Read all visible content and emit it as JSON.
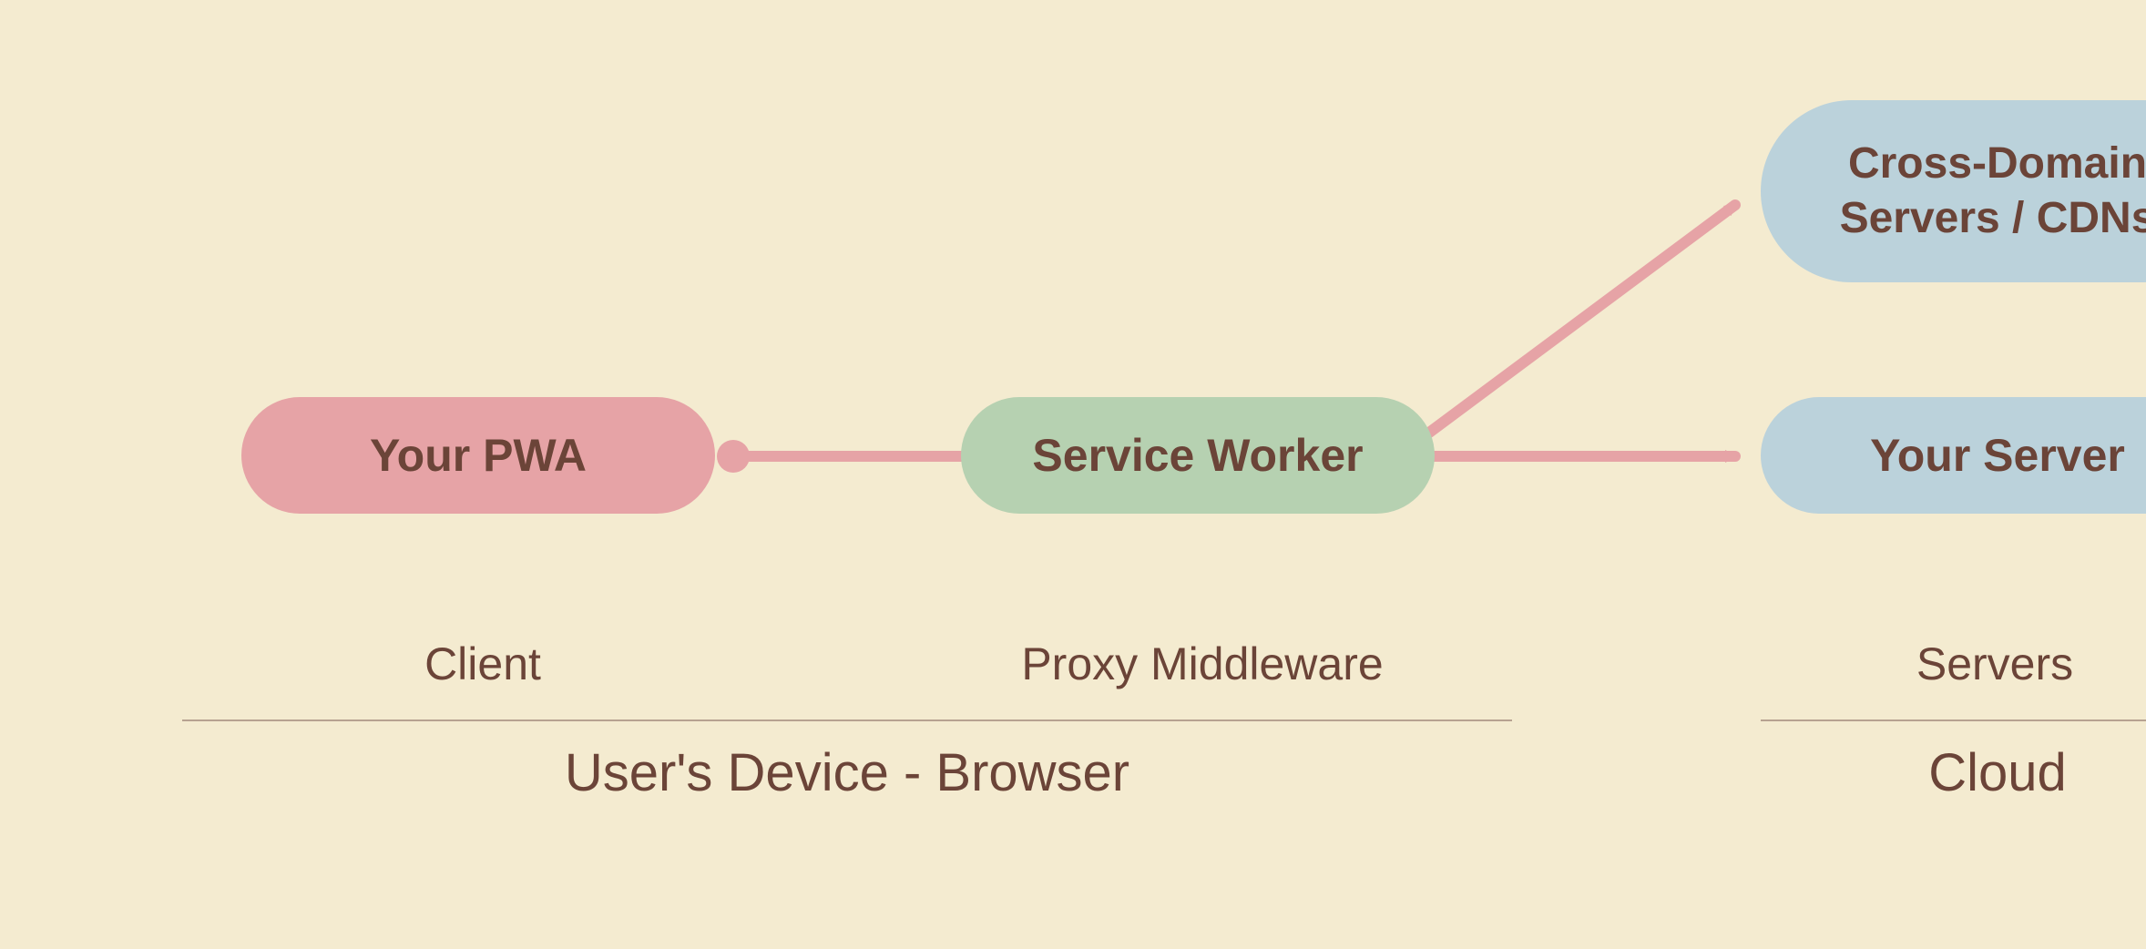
{
  "nodes": {
    "pwa": {
      "label": "Your PWA"
    },
    "service_worker": {
      "label": "Service Worker"
    },
    "cross_domain": {
      "label": "Cross-Domain\nServers / CDNs"
    },
    "your_server": {
      "label": "Your Server"
    }
  },
  "roles": {
    "client": "Client",
    "proxy": "Proxy Middleware",
    "servers": "Servers"
  },
  "groups": {
    "device": "User's Device - Browser",
    "cloud": "Cloud"
  },
  "colors": {
    "background": "#f4ebd0",
    "text": "#6b4438",
    "pink_node": "#e6a3a6",
    "green_node": "#b6d1b1",
    "blue_node": "#bbd2db",
    "arrow": "#e6a3a6",
    "rule": "#b7a291"
  },
  "connections": [
    {
      "from": "pwa",
      "to": "service_worker",
      "style": "line-dot"
    },
    {
      "from": "service_worker",
      "to": "cross_domain",
      "style": "arrow"
    },
    {
      "from": "service_worker",
      "to": "your_server",
      "style": "arrow"
    }
  ]
}
